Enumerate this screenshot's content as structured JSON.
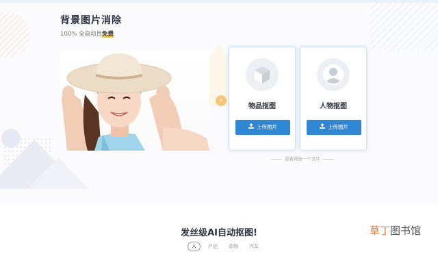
{
  "hero": {
    "title": "背景图片消除",
    "subtitle_prefix": "100% 全自动且",
    "subtitle_highlight": "免费"
  },
  "cards": {
    "object": {
      "label": "物品抠图",
      "button": "上传图片",
      "icon": "box-icon"
    },
    "person": {
      "label": "人物抠图",
      "button": "上传图片",
      "icon": "person-avatar-icon"
    }
  },
  "drag_hint": "或者拖放一个文件",
  "section": {
    "title": "发丝级AI自动抠图!",
    "tabs": [
      "人",
      "产品",
      "动物",
      "汽车"
    ],
    "active_tab": "人"
  },
  "watermark": {
    "part1": "草丁",
    "part2": "图书馆"
  },
  "colors": {
    "accent": "#2f87d3",
    "highlight": "#f7c948",
    "watermark": "#e3702b"
  }
}
